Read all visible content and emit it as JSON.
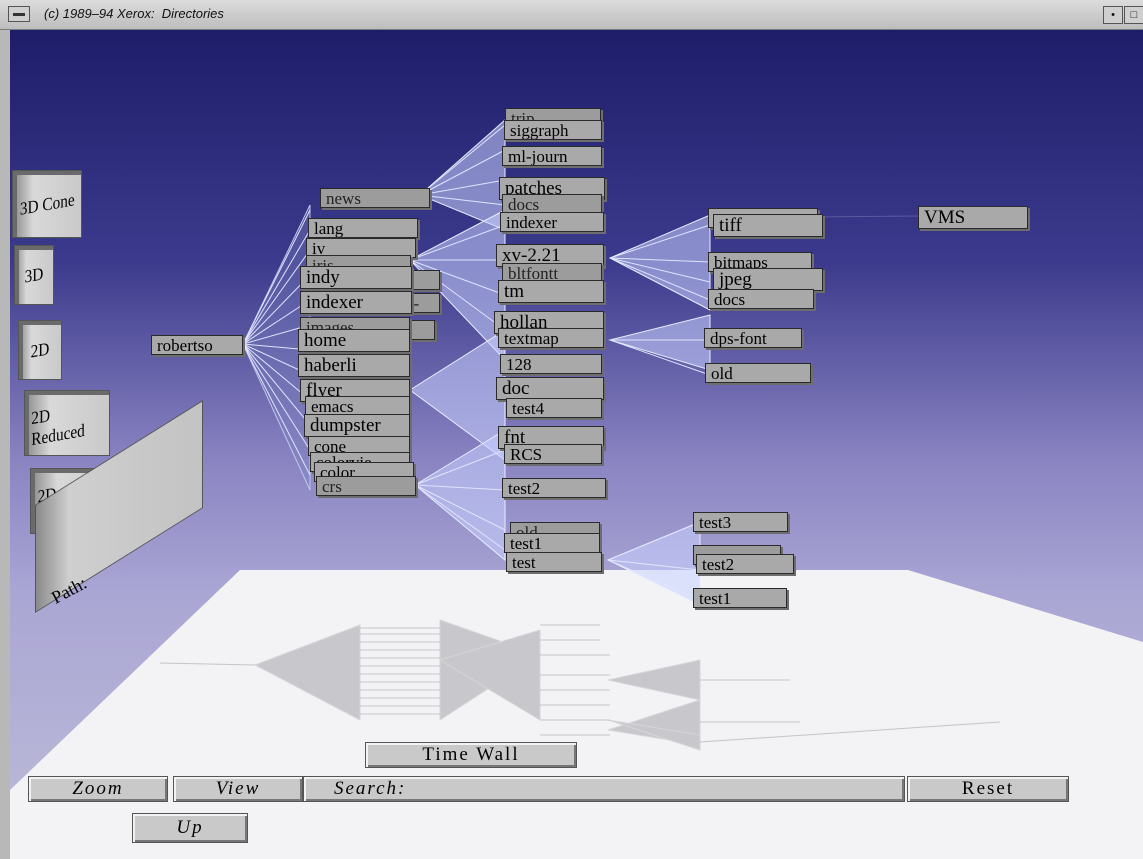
{
  "window": {
    "title": "(c) 1989–94 Xerox:  Directories",
    "right_buttons": [
      "•",
      "□"
    ]
  },
  "side_buttons": [
    "3D Cone",
    "3D",
    "2D",
    "2D Reduced",
    "2D Graphed"
  ],
  "path_field": {
    "label": "Path:",
    "value": ""
  },
  "bottom_bar": {
    "time_wall": "Time Wall",
    "zoom": "Zoom",
    "view": "View",
    "search_label": "Search:",
    "search_value": "",
    "reset": "Reset",
    "up": "Up"
  },
  "tree": {
    "root": "robertso",
    "level1": [
      "lang",
      "iv",
      "iris",
      "indy",
      "indexer",
      "images",
      "home",
      "haberli",
      "flyer",
      "emacs",
      "dumpster",
      "cone",
      "colorvie",
      "color",
      "crs",
      "news"
    ],
    "level1_partial": [
      "p",
      "c-",
      "so"
    ],
    "level2": [
      "trip",
      "siggraph",
      "ml-journ",
      "patches",
      "docs",
      "indexer",
      "xv-2.21",
      "bltfontt",
      "tm",
      "hollan",
      "textmap",
      "128",
      "doc",
      "test4",
      "fnt",
      "RCS",
      "test2",
      "old",
      "test1",
      "test"
    ],
    "level3_xv": [
      "tiff",
      "bitmaps",
      "jpeg",
      "docs"
    ],
    "level3_textmap": [
      "dps-font",
      "old"
    ],
    "level3_test": [
      "test3",
      "test2",
      "test1"
    ],
    "far": "VMS"
  }
}
